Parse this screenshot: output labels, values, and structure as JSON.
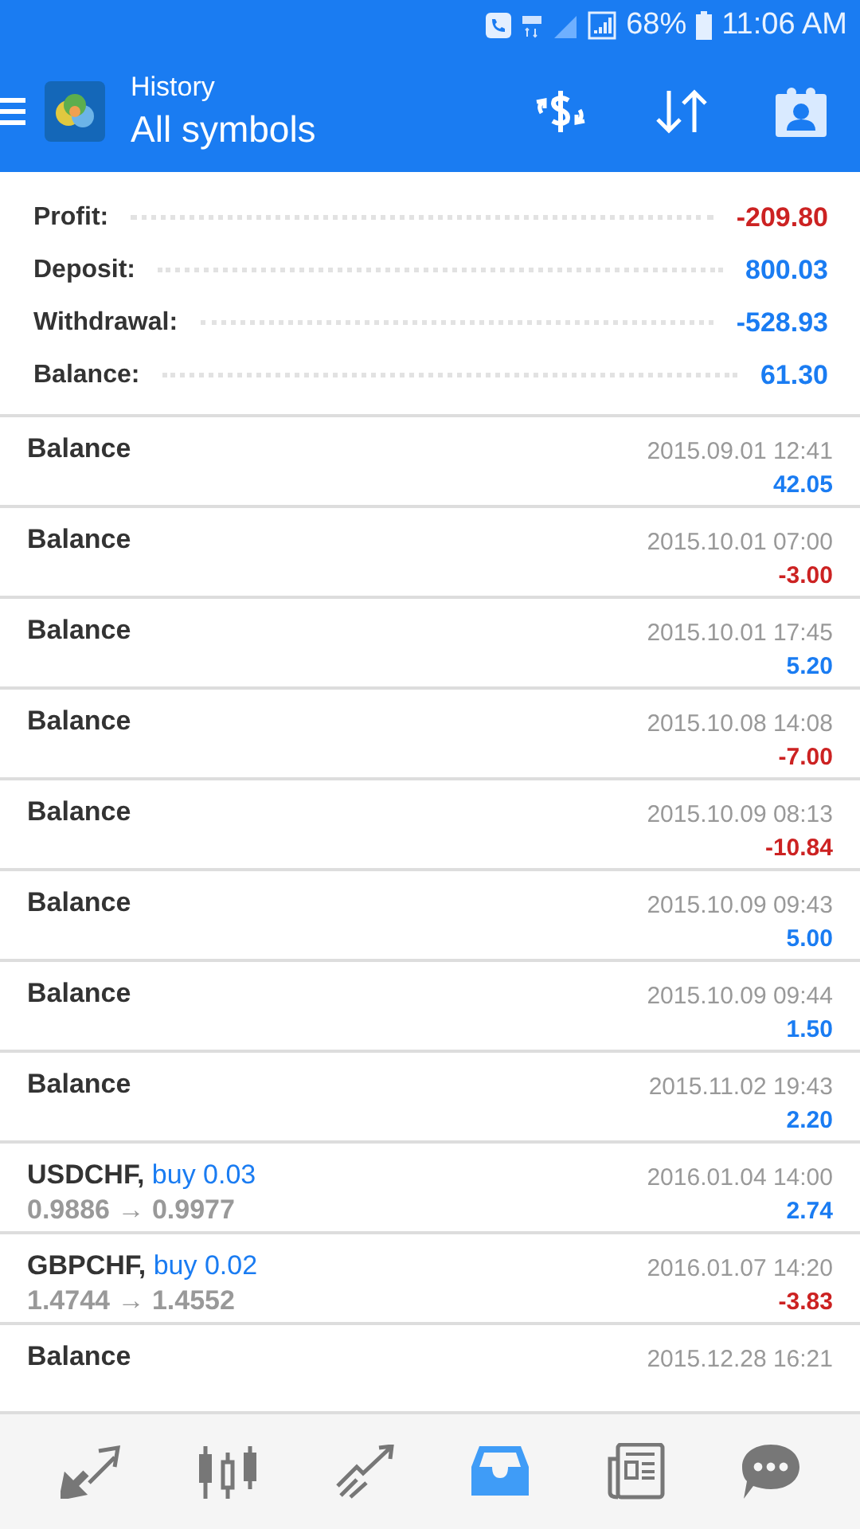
{
  "status_bar": {
    "battery": "68%",
    "time": "11:06 AM"
  },
  "header": {
    "title": "History",
    "subtitle": "All symbols"
  },
  "summary": [
    {
      "label": "Profit:",
      "value": "-209.80",
      "loss": true
    },
    {
      "label": "Deposit:",
      "value": "800.03",
      "loss": false
    },
    {
      "label": "Withdrawal:",
      "value": "-528.93",
      "loss": false
    },
    {
      "label": "Balance:",
      "value": "61.30",
      "loss": false
    }
  ],
  "deals": [
    {
      "kind": "balance",
      "symbol": "Balance",
      "time": "2015.09.01 12:41",
      "profit": "42.05",
      "loss": false
    },
    {
      "kind": "balance",
      "symbol": "Balance",
      "time": "2015.10.01 07:00",
      "profit": "-3.00",
      "loss": true
    },
    {
      "kind": "balance",
      "symbol": "Balance",
      "time": "2015.10.01 17:45",
      "profit": "5.20",
      "loss": false
    },
    {
      "kind": "balance",
      "symbol": "Balance",
      "time": "2015.10.08 14:08",
      "profit": "-7.00",
      "loss": true
    },
    {
      "kind": "balance",
      "symbol": "Balance",
      "time": "2015.10.09 08:13",
      "profit": "-10.84",
      "loss": true
    },
    {
      "kind": "balance",
      "symbol": "Balance",
      "time": "2015.10.09 09:43",
      "profit": "5.00",
      "loss": false
    },
    {
      "kind": "balance",
      "symbol": "Balance",
      "time": "2015.10.09 09:44",
      "profit": "1.50",
      "loss": false
    },
    {
      "kind": "balance",
      "symbol": "Balance",
      "time": "2015.11.02 19:43",
      "profit": "2.20",
      "loss": false
    },
    {
      "kind": "trade",
      "symbol": "USDCHF,",
      "side": "buy 0.03",
      "prices": "0.9886 → 0.9977",
      "time": "2016.01.04 14:00",
      "profit": "2.74",
      "loss": false
    },
    {
      "kind": "trade",
      "symbol": "GBPCHF,",
      "side": "buy 0.02",
      "prices": "1.4744 → 1.4552",
      "time": "2016.01.07 14:20",
      "profit": "-3.83",
      "loss": true
    },
    {
      "kind": "balance",
      "symbol": "Balance",
      "time": "2015.12.28 16:21"
    }
  ],
  "nav": [
    {
      "kind": "trade",
      "selected": false
    },
    {
      "kind": "candles",
      "selected": false
    },
    {
      "kind": "chart",
      "selected": false
    },
    {
      "kind": "inbox",
      "selected": true
    },
    {
      "kind": "news",
      "selected": false
    },
    {
      "kind": "chat",
      "selected": false
    }
  ]
}
